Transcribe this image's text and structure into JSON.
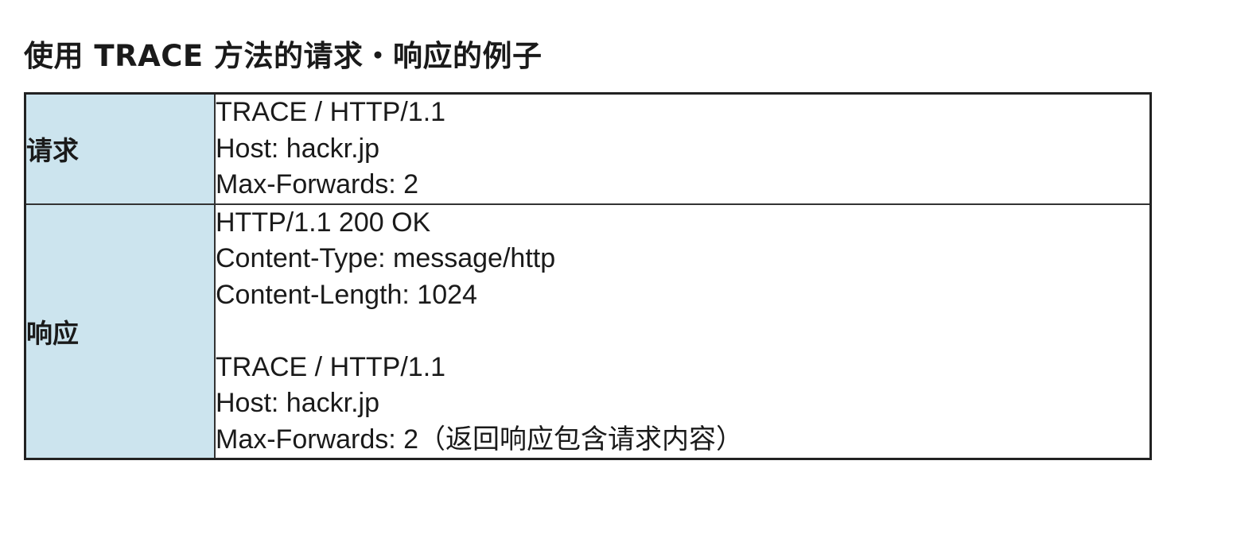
{
  "title": "使用 TRACE 方法的请求・响应的例子",
  "rows": [
    {
      "label": "请求",
      "lines": [
        "TRACE / HTTP/1.1",
        "Host: hackr.jp",
        "Max-Forwards: 2"
      ]
    },
    {
      "label": "响应",
      "lines": [
        "HTTP/1.1 200 OK",
        "Content-Type: message/http",
        "Content-Length: 1024",
        "",
        "TRACE / HTTP/1.1",
        "Host: hackr.jp",
        "Max-Forwards: 2（返回响应包含请求内容）"
      ]
    }
  ],
  "colors": {
    "label_background": "#cce4ee",
    "border": "#222222",
    "text": "#1a1a1a"
  }
}
